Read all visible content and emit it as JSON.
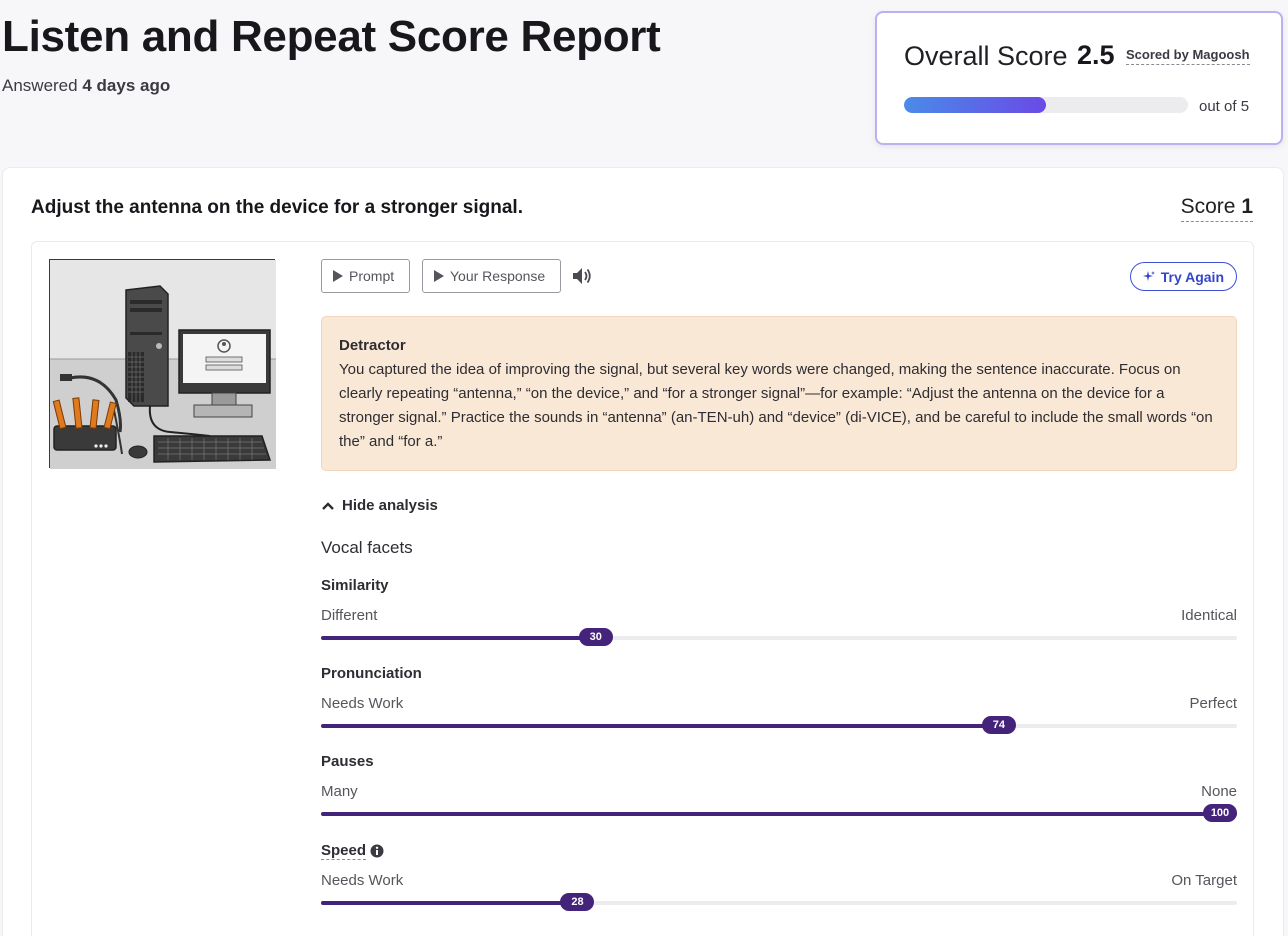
{
  "header": {
    "title": "Listen and Repeat Score Report",
    "answered_prefix": "Answered",
    "answered_when": "4 days ago"
  },
  "overall": {
    "label": "Overall Score",
    "value": "2.5",
    "scored_by": "Scored by Magoosh",
    "out_of": "out of 5",
    "progress_fraction": 0.5
  },
  "item": {
    "sentence": "Adjust the antenna on the device for a stronger signal.",
    "score_label": "Score",
    "score_value": "1"
  },
  "controls": {
    "prompt_label": "Prompt",
    "response_label": "Your Response",
    "try_again_label": "Try Again"
  },
  "detractor": {
    "title": "Detractor",
    "text": "You captured the idea of improving the signal, but several key words were changed, making the sentence inaccurate. Focus on clearly repeating “antenna,” “on the device,” and “for a stronger signal”—for example: “Adjust the antenna on the device for a stronger signal.” Practice the sounds in “antenna” (an-TEN-uh) and “device” (di-VICE), and be careful to include the small words “on the” and “for a.”"
  },
  "analysis": {
    "toggle_label": "Hide analysis",
    "section_title": "Vocal facets",
    "facets": [
      {
        "name": "Similarity",
        "left": "Different",
        "right": "Identical",
        "value": 30,
        "display": "30"
      },
      {
        "name": "Pronunciation",
        "left": "Needs Work",
        "right": "Perfect",
        "value": 74,
        "display": "74"
      },
      {
        "name": "Pauses",
        "left": "Many",
        "right": "None",
        "value": 100,
        "display": "100"
      },
      {
        "name": "Speed",
        "left": "Needs Work",
        "right": "On Target",
        "value": 28,
        "display": "28"
      }
    ]
  },
  "colors": {
    "accent": "#44237a",
    "detractor_bg": "#fae8d6",
    "try_again": "#3445c9",
    "gradient_start": "#4a8be8",
    "gradient_end": "#6a4ae6"
  },
  "icons": {
    "play": "play-icon",
    "audio": "speaker-icon",
    "sparkle": "sparkle-icon",
    "chevron": "chevron-up-icon",
    "info": "info-icon"
  }
}
